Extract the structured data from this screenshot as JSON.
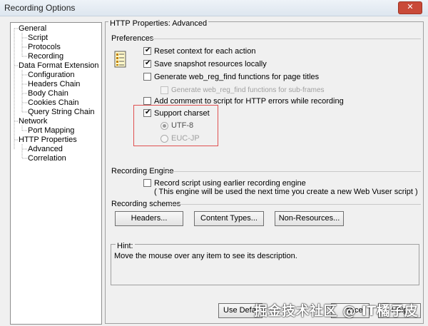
{
  "window": {
    "title": "Recording Options",
    "close_glyph": "✕"
  },
  "tree": {
    "items": [
      {
        "label": "General"
      },
      {
        "label": "Script"
      },
      {
        "label": "Protocols"
      },
      {
        "label": "Recording"
      },
      {
        "label": "Data Format Extension"
      },
      {
        "label": "Configuration"
      },
      {
        "label": "Headers Chain"
      },
      {
        "label": "Body Chain"
      },
      {
        "label": "Cookies Chain"
      },
      {
        "label": "Query String Chain"
      },
      {
        "label": "Network"
      },
      {
        "label": "Port Mapping"
      },
      {
        "label": "HTTP Properties"
      },
      {
        "label": "Advanced"
      },
      {
        "label": "Correlation"
      }
    ]
  },
  "main": {
    "group_title": "HTTP Properties: Advanced",
    "preferences": {
      "label": "Preferences",
      "options": [
        {
          "label": "Reset context for each action",
          "checked": true
        },
        {
          "label": "Save snapshot resources locally",
          "checked": true
        },
        {
          "label": "Generate web_reg_find functions for page titles",
          "checked": false
        },
        {
          "label": "Generate web_reg_find functions for sub-frames",
          "checked": false,
          "disabled": true
        },
        {
          "label": "Add comment to script for HTTP errors while recording",
          "checked": false
        },
        {
          "label": "Support charset",
          "checked": true
        }
      ],
      "charset": [
        {
          "label": "UTF-8",
          "selected": true
        },
        {
          "label": "EUC-JP",
          "selected": false
        }
      ]
    },
    "engine": {
      "label": "Recording Engine",
      "option": "Record script using earlier recording engine",
      "note": "( This engine will be used the next time you create a new Web Vuser script )"
    },
    "schemes": {
      "label": "Recording schemes",
      "buttons": [
        "Headers...",
        "Content Types...",
        "Non-Resources..."
      ]
    },
    "hint": {
      "title": "Hint:",
      "text": "Move the mouse over any item to see its description."
    }
  },
  "footer": {
    "use_default": "Use Defaul",
    "cancel": "ancel",
    "help": "Help"
  },
  "watermark": "掘金技术社区 @ IT橘子皮",
  "colors": {
    "highlight": "#e05050"
  }
}
